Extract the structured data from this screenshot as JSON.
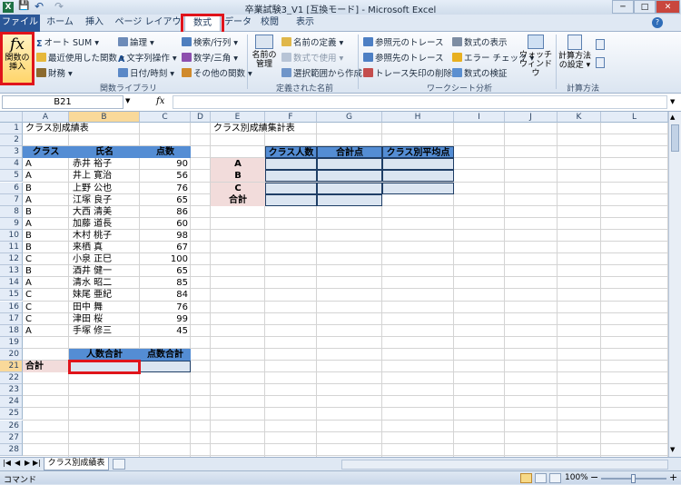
{
  "title": "卒業試験3_V1 [互換モード] - Microsoft Excel",
  "qat": {
    "excel_icon": "X",
    "save": "💾",
    "undo": "↶",
    "redo": "↷"
  },
  "tabs": [
    "ファイル",
    "ホーム",
    "挿入",
    "ページ レイアウト",
    "数式",
    "データ",
    "校閲",
    "表示"
  ],
  "ribbon": {
    "insert_fn": [
      "関数の",
      "挿入"
    ],
    "lib": [
      "オート SUM ▾",
      "最近使用した関数 ▾",
      "財務 ▾",
      "論理 ▾",
      "文字列操作 ▾",
      "日付/時刻 ▾",
      "検索/行列 ▾",
      "数学/三角 ▾",
      "その他の関数 ▾"
    ],
    "lib_label": "関数ライブラリ",
    "names_big": [
      "名前の",
      "管理"
    ],
    "names": [
      "名前の定義 ▾",
      "数式で使用 ▾",
      "選択範囲から作成"
    ],
    "names_label": "定義された名前",
    "audit": [
      "参照元のトレース",
      "参照先のトレース",
      "トレース矢印の削除 ▾",
      "数式の表示",
      "エラー チェック ▾",
      "数式の検証"
    ],
    "watch": [
      "ウォッチ",
      "ウィンドウ"
    ],
    "audit_label": "ワークシート分析",
    "calc": [
      "計算方法",
      "の設定 ▾"
    ],
    "calc_label": "計算方法"
  },
  "namebox": "B21",
  "fx": "fx",
  "columns": [
    "A",
    "B",
    "C",
    "D",
    "E",
    "F",
    "G",
    "H",
    "I",
    "J",
    "K",
    "L"
  ],
  "rows": [
    "1",
    "2",
    "3",
    "4",
    "5",
    "6",
    "7",
    "8",
    "9",
    "10",
    "11",
    "12",
    "13",
    "14",
    "15",
    "16",
    "17",
    "18",
    "19",
    "20",
    "21",
    "22",
    "23",
    "24",
    "25",
    "26",
    "27",
    "28"
  ],
  "sheet": {
    "title1": "クラス別成績表",
    "title2": "クラス別成績集計表",
    "headers": [
      "クラス",
      "氏名",
      "点数"
    ],
    "data": [
      [
        "A",
        "赤井 裕子",
        "90"
      ],
      [
        "A",
        "井上 寛治",
        "56"
      ],
      [
        "B",
        "上野 公也",
        "76"
      ],
      [
        "A",
        "江塚 良子",
        "65"
      ],
      [
        "B",
        "大西 清美",
        "86"
      ],
      [
        "A",
        "加藤 道長",
        "60"
      ],
      [
        "B",
        "木村 桃子",
        "98"
      ],
      [
        "B",
        "来栖 真",
        "67"
      ],
      [
        "C",
        "小泉 正巳",
        "100"
      ],
      [
        "B",
        "酒井 健一",
        "65"
      ],
      [
        "A",
        "清水 昭二",
        "85"
      ],
      [
        "C",
        "妹尾 亜紀",
        "84"
      ],
      [
        "C",
        "田中 舞",
        "76"
      ],
      [
        "C",
        "津田 桜",
        "99"
      ],
      [
        "A",
        "手塚 修三",
        "45"
      ]
    ],
    "sum_headers": [
      "クラス人数",
      "合計点",
      "クラス別平均点"
    ],
    "sum_rows": [
      "A",
      "B",
      "C",
      "合計"
    ],
    "count_headers": [
      "人数合計",
      "点数合計"
    ],
    "total_label": "合計"
  },
  "sheet_tab": "クラス別成績表",
  "status": {
    "mode": "コマンド",
    "zoom": "100%"
  },
  "colors": {
    "header_blue": "#548dd4",
    "cell_blue": "#dbe5f1",
    "label_pink": "#f2dcdb",
    "highlight": "#e0141b"
  }
}
